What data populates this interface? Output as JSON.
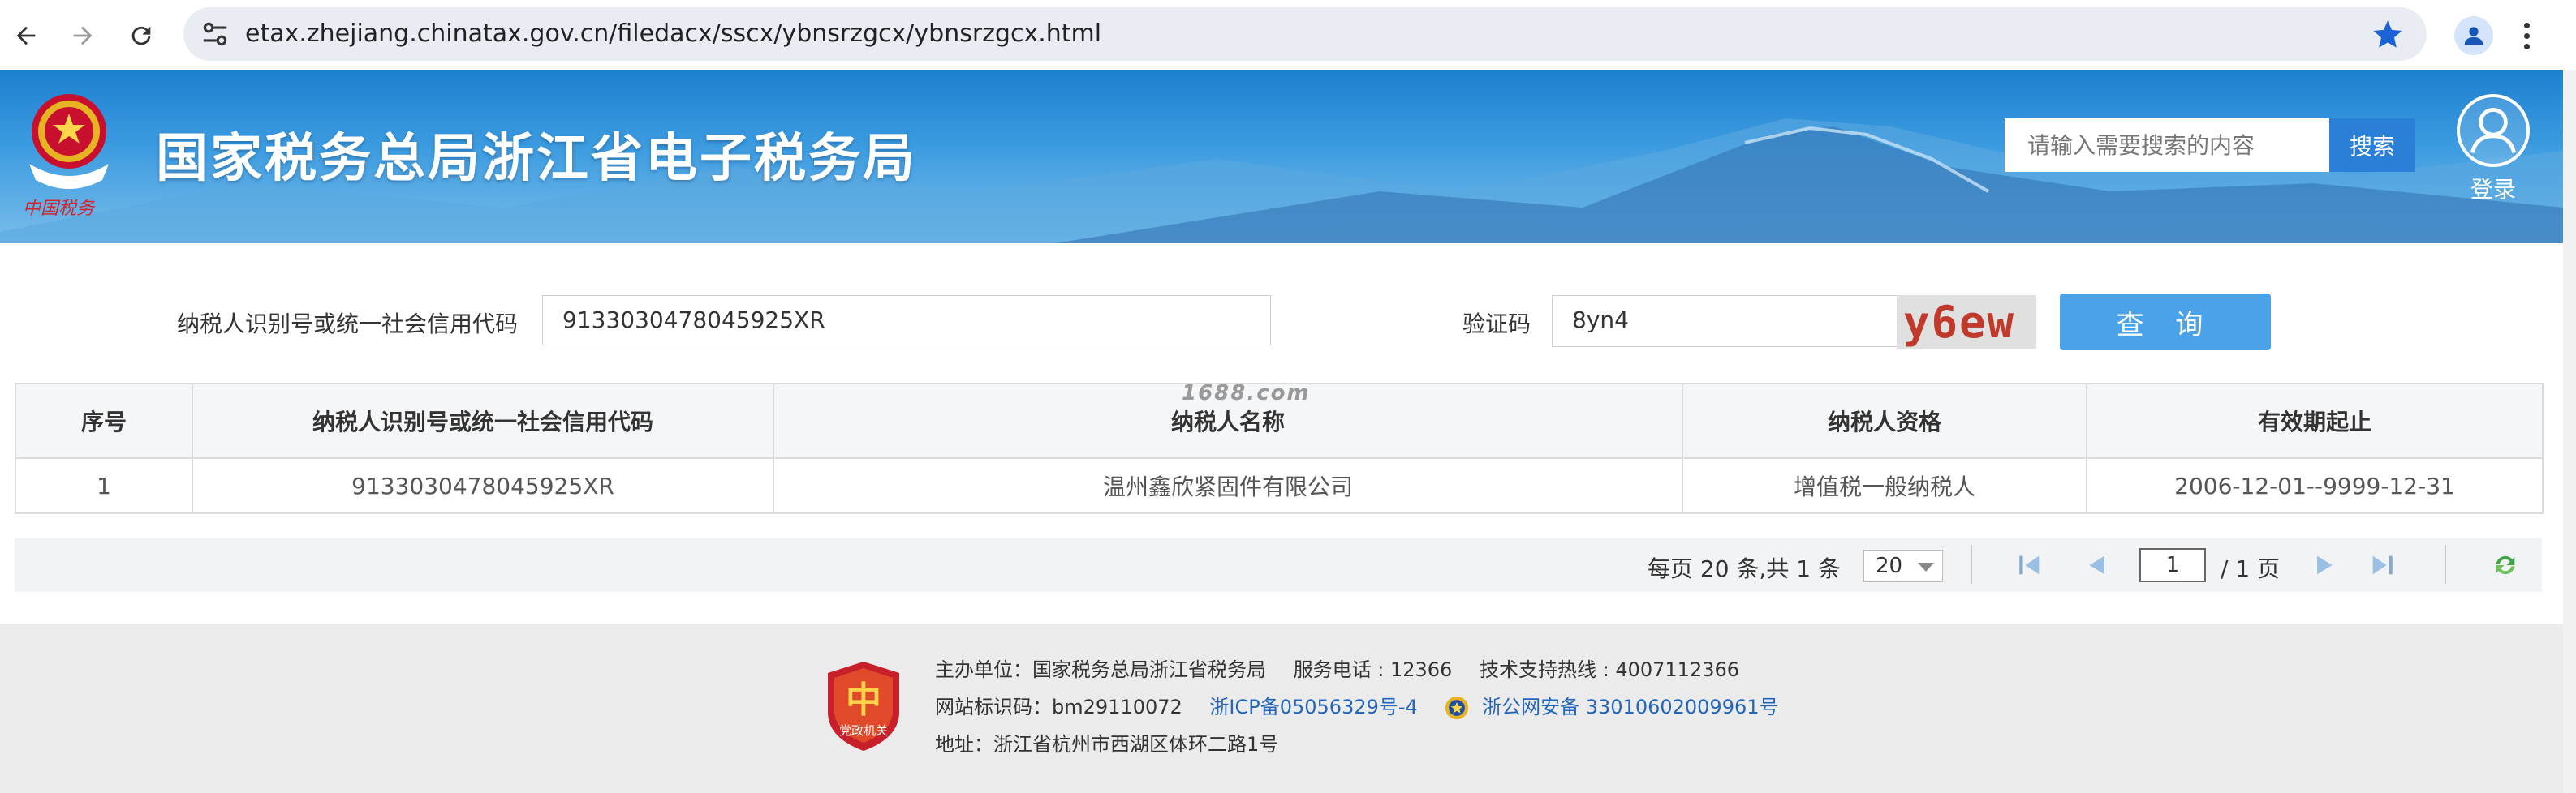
{
  "browser": {
    "url": "etax.zhejiang.chinatax.gov.cn/filedacx/sscx/ybnsrzgcx/ybnsrzgcx.html"
  },
  "header": {
    "site_title": "国家税务总局浙江省电子税务局",
    "search_placeholder": "请输入需要搜索的内容",
    "search_button": "搜索",
    "login_label": "登录",
    "emblem_caption": "中国税务"
  },
  "form": {
    "taxpayer_id_label": "纳税人识别号或统一社会信用代码",
    "taxpayer_id_value": "9133030478045925XR",
    "captcha_label": "验证码",
    "captcha_value": "8yn4",
    "captcha_image_text": "y6ew",
    "query_button": "查 询"
  },
  "table": {
    "headers": [
      "序号",
      "纳税人识别号或统一社会信用代码",
      "纳税人名称",
      "纳税人资格",
      "有效期起止"
    ],
    "rows": [
      [
        "1",
        "9133030478045925XR",
        "温州鑫欣紧固件有限公司",
        "增值税一般纳税人",
        "2006-12-01--9999-12-31"
      ]
    ],
    "watermark": "1688.com"
  },
  "pager": {
    "summary": "每页 20 条,共 1 条",
    "page_size": "20",
    "current_page": "1",
    "total_pages": "/ 1 页"
  },
  "footer": {
    "logo_caption": "党政机关",
    "sponsor": "主办单位：国家税务总局浙江省税务局",
    "service_phone": "服务电话 : 12366",
    "support_hotline": "技术支持热线 : 4007112366",
    "site_id": "网站标识码：bm29110072",
    "icp": "浙ICP备05056329号-4",
    "police_record": "浙公网安备 33010602009961号",
    "address": "地址：浙江省杭州市西湖区体环二路1号"
  }
}
